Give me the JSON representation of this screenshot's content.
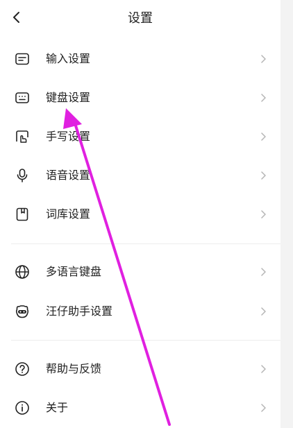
{
  "header": {
    "title": "设置",
    "back_icon": "back-arrow-icon"
  },
  "groups": [
    {
      "items": [
        {
          "id": "input",
          "label": "输入设置",
          "icon": "input-settings-icon"
        },
        {
          "id": "keyboard",
          "label": "键盘设置",
          "icon": "keyboard-icon"
        },
        {
          "id": "handwriting",
          "label": "手写设置",
          "icon": "handwriting-icon"
        },
        {
          "id": "voice",
          "label": "语音设置",
          "icon": "microphone-icon"
        },
        {
          "id": "dictionary",
          "label": "词库设置",
          "icon": "dictionary-icon"
        }
      ]
    },
    {
      "items": [
        {
          "id": "multilang",
          "label": "多语言键盘",
          "icon": "globe-icon"
        },
        {
          "id": "assistant",
          "label": "汪仔助手设置",
          "icon": "mascot-icon"
        }
      ]
    },
    {
      "items": [
        {
          "id": "help",
          "label": "帮助与反馈",
          "icon": "help-icon"
        },
        {
          "id": "about",
          "label": "关于",
          "icon": "info-icon"
        }
      ]
    }
  ],
  "colors": {
    "annotation_arrow": "#e020e0",
    "icon": "#222222",
    "chevron": "#b5b5b5",
    "divider": "#ececec"
  }
}
